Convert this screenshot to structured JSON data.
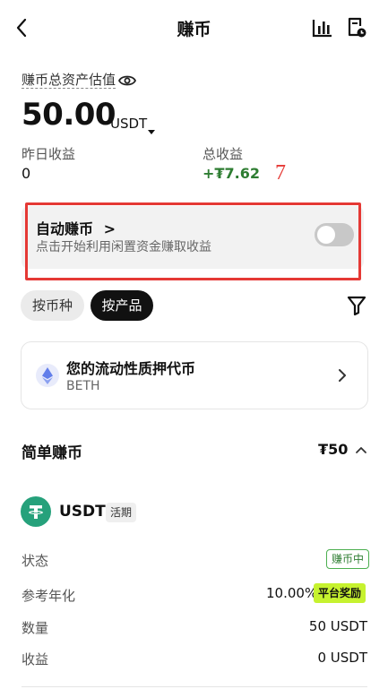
{
  "header": {
    "title": "赚币",
    "back_icon": "chevron-left-icon",
    "chart_icon": "bar-chart-icon",
    "history_icon": "document-clock-icon"
  },
  "summary": {
    "label": "赚币总资产估值",
    "amount": "50.00",
    "unit": "USDT",
    "yesterday_label": "昨日收益",
    "yesterday_value": "0",
    "total_label": "总收益",
    "total_value": "+₮7.62",
    "annotation": "7"
  },
  "auto_earn": {
    "title": "自动赚币",
    "chevron": ">",
    "subtitle": "点击开始利用闲置资金赚取收益",
    "enabled": false
  },
  "filters": {
    "by_coin": "按币种",
    "by_product": "按产品"
  },
  "promo_card": {
    "title": "您的流动性质押代币",
    "subtitle": "BETH"
  },
  "section": {
    "title": "简单赚币",
    "amount": "₮50"
  },
  "product": {
    "name": "USDT",
    "tag": "活期",
    "rows": [
      {
        "label": "状态",
        "value": "赚币中"
      },
      {
        "label": "参考年化",
        "value": "10.00%",
        "badge": "平台奖励"
      },
      {
        "label": "数量",
        "value": "50 USDT"
      },
      {
        "label": "收益",
        "value": "0 USDT"
      }
    ]
  },
  "colors": {
    "accent_green": "#2e7d32",
    "annotation_red": "#e53935",
    "bonus_lime": "#c6f22f",
    "tether_green": "#26a17b"
  }
}
